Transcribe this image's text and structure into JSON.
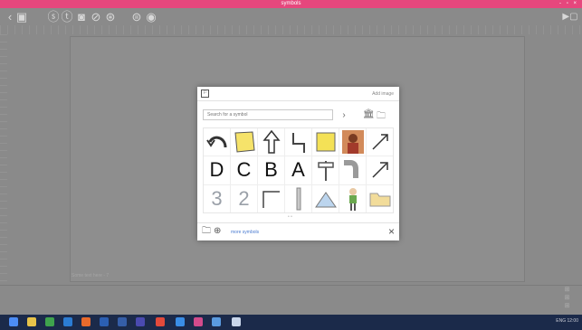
{
  "window": {
    "title": "symbols",
    "controls": "- ▫ ×"
  },
  "toolbar": {
    "buttons": [
      {
        "name": "back",
        "glyph": "‹"
      },
      {
        "name": "save",
        "glyph": "▣"
      },
      {
        "name": "tool-a",
        "glyph": "ⓢ"
      },
      {
        "name": "tool-t",
        "glyph": "ⓣ"
      },
      {
        "name": "tool-img",
        "glyph": "◙"
      },
      {
        "name": "tool-line",
        "glyph": "⊘"
      },
      {
        "name": "tool-shape",
        "glyph": "⊛"
      },
      {
        "name": "tool-sym",
        "glyph": "⊜"
      },
      {
        "name": "tool-eraser",
        "glyph": "◉"
      }
    ],
    "right_glyph": "▶▢"
  },
  "canvas": {
    "label": "Some text here - 7"
  },
  "dialog": {
    "mode_label": "Add image",
    "search_placeholder": "Search for a symbol",
    "symbols": [
      {
        "kind": "curve-arrow"
      },
      {
        "kind": "yellow-note"
      },
      {
        "kind": "up-arrow"
      },
      {
        "kind": "step-line"
      },
      {
        "kind": "yellow-note2"
      },
      {
        "kind": "photo-person"
      },
      {
        "kind": "diag-arrow"
      },
      {
        "kind": "letter",
        "text": "D"
      },
      {
        "kind": "letter",
        "text": "C"
      },
      {
        "kind": "letter",
        "text": "B"
      },
      {
        "kind": "letter",
        "text": "A"
      },
      {
        "kind": "signpost"
      },
      {
        "kind": "bent-pipe"
      },
      {
        "kind": "diag-arrow2"
      },
      {
        "kind": "digit",
        "text": "3"
      },
      {
        "kind": "digit",
        "text": "2"
      },
      {
        "kind": "corner"
      },
      {
        "kind": "bar"
      },
      {
        "kind": "tent"
      },
      {
        "kind": "figure"
      },
      {
        "kind": "folder"
      }
    ],
    "pager": "• •",
    "footer_link": "more symbols",
    "close_glyph": "×"
  },
  "bottom": {
    "side_glyphs": [
      "⊞",
      "⊞",
      "⊞"
    ]
  },
  "taskbar": {
    "tray_text": "ENG 12:00"
  }
}
